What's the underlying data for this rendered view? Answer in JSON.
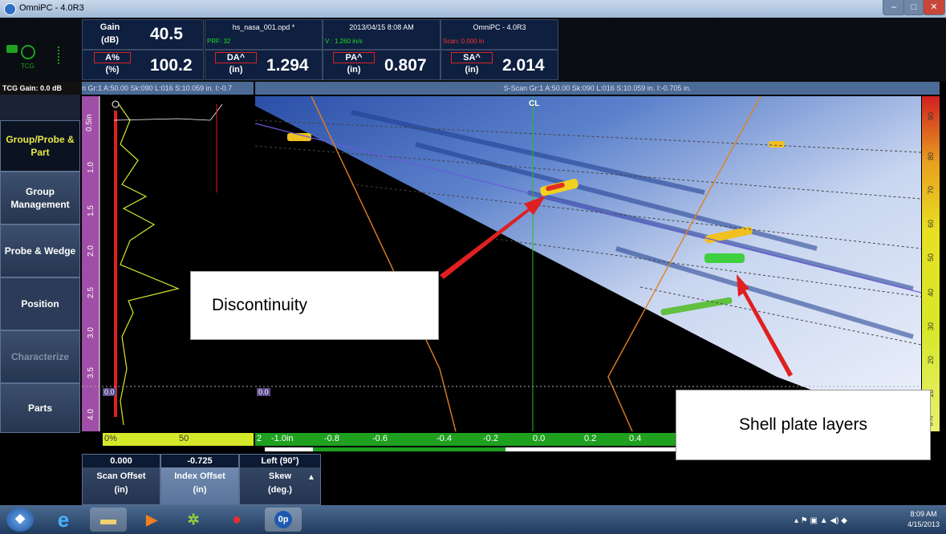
{
  "window": {
    "title": "OmniPC - 4.0R3"
  },
  "header": {
    "gain": {
      "label_top": "Gain",
      "label_unit": "(dB)",
      "value": "40.5"
    },
    "apct": {
      "label": "A%",
      "unit": "(%)",
      "value": "100.2"
    },
    "da": {
      "label": "DA^",
      "unit": "(in)",
      "value": "1.294"
    },
    "pa": {
      "label": "PA^",
      "unit": "(in)",
      "value": "0.807"
    },
    "sa": {
      "label": "SA^",
      "unit": "(in)",
      "value": "2.014"
    },
    "file": {
      "title": "hs_nasa_001.opd *",
      "sub": "PRF: 32"
    },
    "datetime": {
      "title": "2013/04/15 8:08 AM",
      "sub": "V : 1.260 in/s"
    },
    "app": {
      "title": "OmniPC - 4.0R3",
      "sub": "Scan: 0.000 in"
    },
    "tcg_label": "TCG",
    "tcg_gain": "TCG Gain: 0.0 dB"
  },
  "ascan": {
    "header": "n Gr:1 A:50.00 Sk:090 L:016 S:10.059 in. I:-0.7",
    "ticks": [
      "0.5in",
      "1.0",
      "1.5",
      "2.0",
      "2.5",
      "3.0",
      "3.5",
      "4.0"
    ],
    "gate": "0.0",
    "axis": [
      "0%",
      "50"
    ]
  },
  "sscan": {
    "header": "S-Scan Gr:1 A:50.00 Sk:090 L:016 S:10.059 in. I:-0.705 in.",
    "cl": "CL",
    "gate": "0.0",
    "axis": [
      "2",
      "-1.0in",
      "-0.8",
      "-0.6",
      "-0.4",
      "-0.2",
      "0.0",
      "0.2",
      "0.4"
    ],
    "color_scale": [
      "90",
      "80",
      "70",
      "60",
      "50",
      "40",
      "30",
      "20",
      "10",
      "0%"
    ]
  },
  "nav": [
    "Group/Probe & Part",
    "Group Management",
    "Probe & Wedge",
    "Position",
    "Characterize",
    "Parts"
  ],
  "bottom": {
    "scan_offset": {
      "value": "0.000",
      "label": "Scan Offset",
      "unit": "(in)"
    },
    "index_offset": {
      "value": "-0.725",
      "label": "Index Offset",
      "unit": "(in)"
    },
    "skew": {
      "value": "Left (90°)",
      "label": "Skew",
      "unit": "(deg.)"
    }
  },
  "callouts": {
    "discontinuity": "Discontinuity",
    "shell": "Shell plate layers"
  },
  "taskbar": {
    "time": "8:09 AM",
    "date": "4/15/2013",
    "op_icon": "0p"
  },
  "colors": {
    "accent_yellow": "#d6e82a",
    "accent_green": "#1fa01f",
    "red": "#e02020"
  }
}
